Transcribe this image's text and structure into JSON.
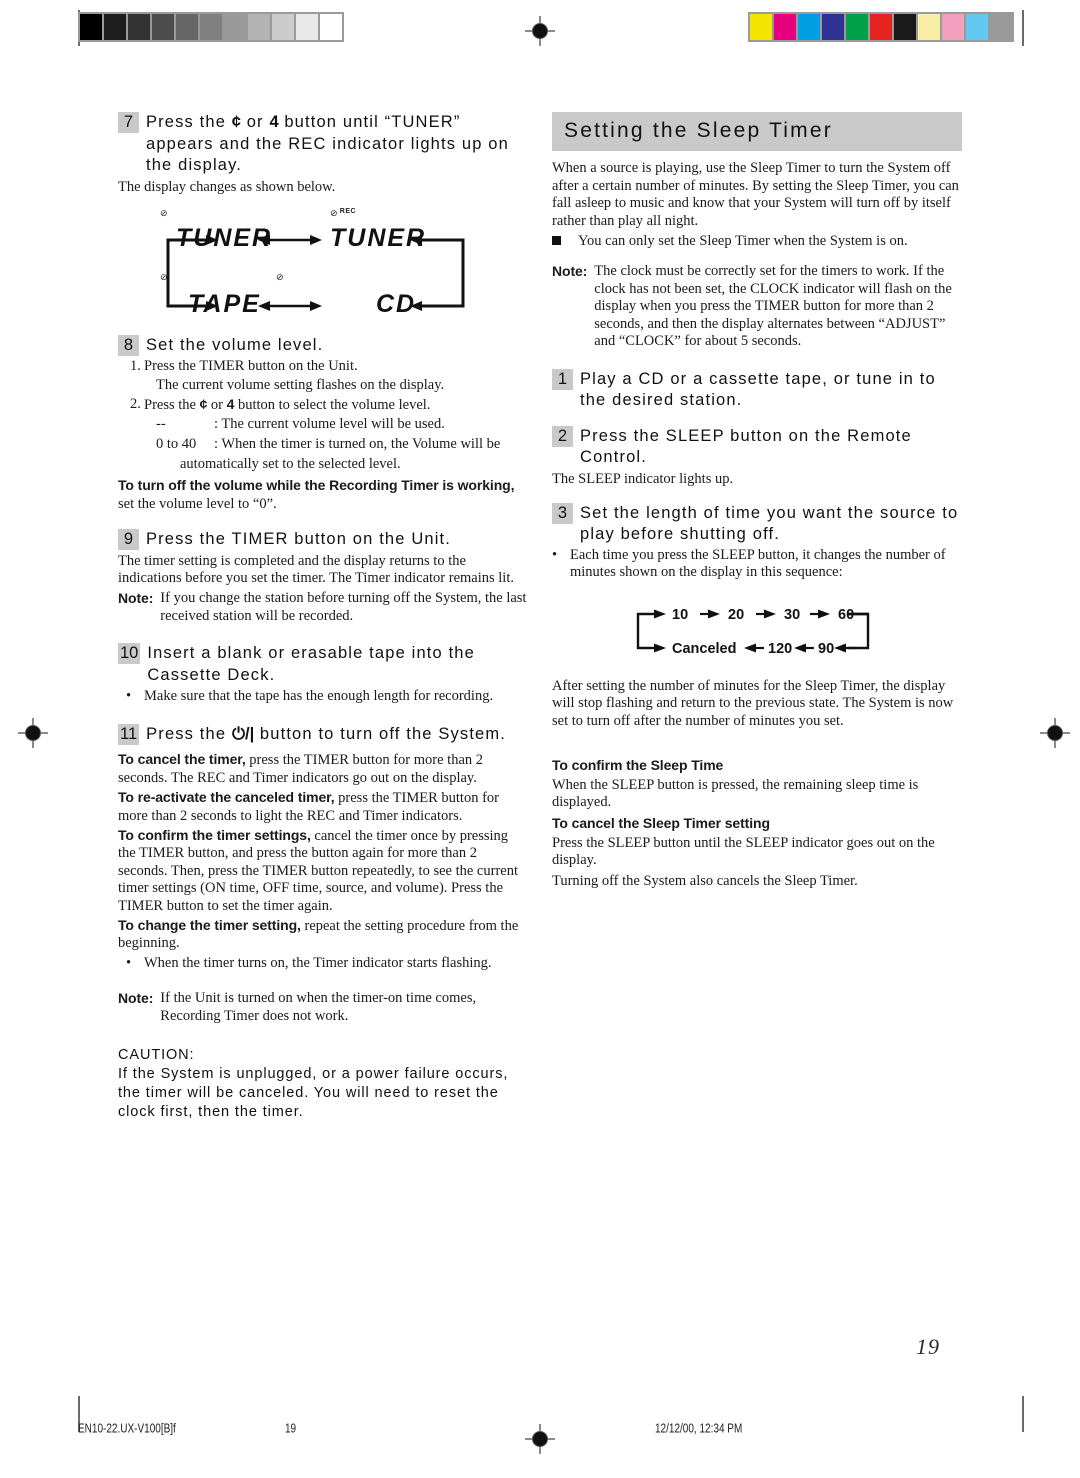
{
  "page": {
    "number": "19",
    "footer": {
      "file": "EN10-22.UX-V100[B]f",
      "page": "19",
      "timestamp": "12/12/00, 12:34 PM"
    }
  },
  "calibration": {
    "gray_label": "grayscale-step-wedge",
    "grayscale": [
      "#000000",
      "#1e1e1e",
      "#333333",
      "#4c4c4c",
      "#666666",
      "#808080",
      "#999999",
      "#b3b3b3",
      "#cccccc",
      "#e8e8e8",
      "#ffffff"
    ],
    "color_label": "color-control-patches",
    "colors": [
      "#f5e400",
      "#e6007e",
      "#009fe3",
      "#2e3192",
      "#00a04a",
      "#e52421",
      "#1a1a1a",
      "#f9eea5",
      "#f3a0bf",
      "#63c8f0",
      "#9a9a9a"
    ]
  },
  "left_column": {
    "step7": {
      "number": "7",
      "heading_parts": [
        "Press the ",
        "¢",
        "  or ",
        "4",
        "   button until “TUNER” appears and the REC indicator lights up on the display."
      ],
      "caption": "The display changes as shown below."
    },
    "display_diagram": {
      "name": "source-cycle-display",
      "top_left_word": "TUNER",
      "top_right_word": "TUNER",
      "bottom_left_word": "TAPE",
      "bottom_right_word": "CD",
      "indicator_clock": "⊘",
      "indicator_rec": "REC"
    },
    "step8": {
      "number": "8",
      "heading": "Set the volume level.",
      "items": [
        {
          "marker": "1.",
          "text": "Press the TIMER button on the Unit.",
          "sub": "The current volume setting flashes on the display."
        },
        {
          "marker": "2.",
          "text_pre": "Press the ",
          "sym1": "¢",
          "text_mid": "   or ",
          "sym2": "4",
          "text_post": "   button to select the volume level."
        }
      ],
      "value_rows": [
        {
          "label": "--",
          "value": ": The current volume level will be used."
        },
        {
          "label": "0 to 40",
          "value": ": When the timer is turned on, the Volume will be",
          "cont": "automatically set to the selected level."
        }
      ],
      "tip_bold": "To turn off the volume while the Recording Timer is working,",
      "tip_rest": " set the volume level to “0”."
    },
    "step9": {
      "number": "9",
      "heading": "Press the TIMER button on the Unit.",
      "body": "The timer setting is completed and the display returns to the indications before you set the timer. The Timer indicator remains lit.",
      "note_label": "Note:",
      "note_text": "If you change the station before turning off the System, the last received station will  be recorded."
    },
    "step10": {
      "number": "10",
      "heading": "Insert a blank or erasable tape into the Cassette Deck.",
      "bullet": "Make sure that the tape has the enough length for recording."
    },
    "step11": {
      "number": "11",
      "heading_pre": "Press the ",
      "heading_sym": "⏻/|",
      "heading_post": " button to turn off the System."
    },
    "tips": [
      {
        "bold": "To cancel the timer,",
        "rest": " press the TIMER button for more than 2 seconds. The REC and Timer indicators go out on the display."
      },
      {
        "bold": "To re-activate the canceled timer,",
        "rest": " press the TIMER button for more than 2 seconds to light the REC and Timer indicators."
      },
      {
        "bold": "To confirm the timer settings,",
        "rest": " cancel the timer once by pressing the TIMER button, and press the button again for more than 2 seconds. Then, press the TIMER button repeatedly, to see the current timer settings (ON time, OFF time, source, and volume). Press the TIMER button to set the timer again."
      },
      {
        "bold": "To change the timer setting,",
        "rest": " repeat the setting procedure from the beginning."
      }
    ],
    "bullet_after_tips": "When the timer turns on, the Timer indicator starts flashing.",
    "final_note": {
      "label": "Note:",
      "text": "If the Unit is turned on when the timer-on time comes, Recording Timer does not work."
    },
    "caution": {
      "title": "CAUTION:",
      "text": "If the System is unplugged, or a power failure occurs, the timer will be canceled. You will need to reset the clock first, then the timer."
    }
  },
  "right_column": {
    "banner": "Setting the Sleep Timer",
    "intro": "When a source is playing, use the Sleep Timer to turn the System off after a certain number of minutes. By setting the Sleep Timer, you can fall asleep to music and know that your System will turn off by itself rather than play all night.",
    "square_bullet": "You can only set the Sleep Timer when the System is on.",
    "note": {
      "label": "Note:",
      "text": "The clock must be correctly set for the timers to work. If the clock has not been set, the CLOCK indicator will flash on the display when you press the TIMER button for more than 2 seconds, and then the display alternates between “ADJUST” and “CLOCK” for about 5 seconds."
    },
    "step1": {
      "number": "1",
      "heading": "Play a CD or a cassette tape, or tune in to the desired station."
    },
    "step2": {
      "number": "2",
      "heading": "Press the SLEEP button on the Remote Control.",
      "body": "The SLEEP indicator lights up."
    },
    "step3": {
      "number": "3",
      "heading": "Set the length of time you want the source to play before shutting off.",
      "bullet": "Each time you press the SLEEP button, it changes the number of minutes shown on the display in this sequence:"
    },
    "sequence": {
      "name": "sleep-timer-sequence",
      "top_row": [
        "10",
        "20",
        "30",
        "60"
      ],
      "bottom_row": [
        "Canceled",
        "120",
        "90"
      ]
    },
    "after_sequence": "After setting the number of minutes for the Sleep Timer, the display will stop flashing and return to the previous state. The System is now set to turn off after the number of minutes you set.",
    "confirm": {
      "title": "To confirm the Sleep Time",
      "body": "When the SLEEP button is pressed, the remaining sleep time is displayed."
    },
    "cancel": {
      "title": "To cancel the Sleep Timer setting",
      "body": "Press the SLEEP button until the SLEEP indicator goes out on the display.",
      "body2": "Turning off the System also cancels the Sleep Timer."
    }
  }
}
